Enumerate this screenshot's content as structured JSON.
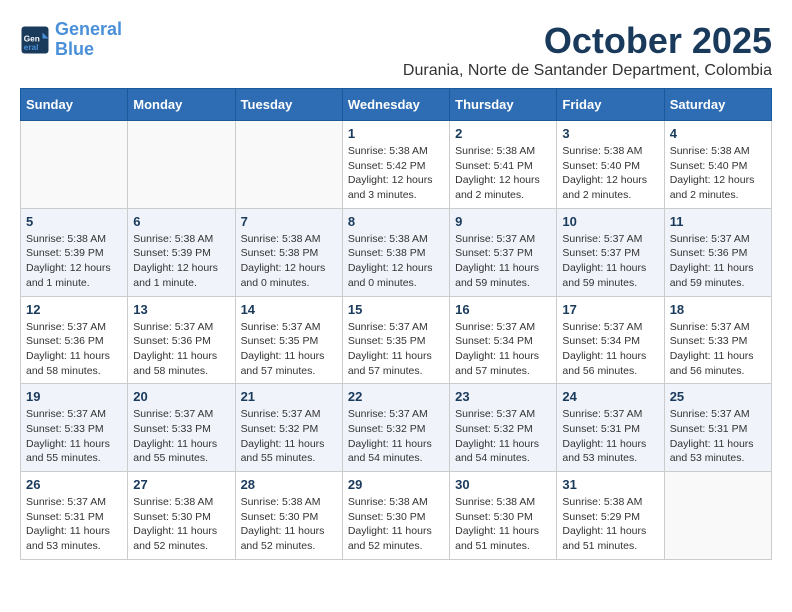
{
  "header": {
    "logo_line1": "General",
    "logo_line2": "Blue",
    "month": "October 2025",
    "location": "Durania, Norte de Santander Department, Colombia"
  },
  "weekdays": [
    "Sunday",
    "Monday",
    "Tuesday",
    "Wednesday",
    "Thursday",
    "Friday",
    "Saturday"
  ],
  "weeks": [
    [
      {
        "day": "",
        "info": ""
      },
      {
        "day": "",
        "info": ""
      },
      {
        "day": "",
        "info": ""
      },
      {
        "day": "1",
        "info": "Sunrise: 5:38 AM\nSunset: 5:42 PM\nDaylight: 12 hours and 3 minutes."
      },
      {
        "day": "2",
        "info": "Sunrise: 5:38 AM\nSunset: 5:41 PM\nDaylight: 12 hours and 2 minutes."
      },
      {
        "day": "3",
        "info": "Sunrise: 5:38 AM\nSunset: 5:40 PM\nDaylight: 12 hours and 2 minutes."
      },
      {
        "day": "4",
        "info": "Sunrise: 5:38 AM\nSunset: 5:40 PM\nDaylight: 12 hours and 2 minutes."
      }
    ],
    [
      {
        "day": "5",
        "info": "Sunrise: 5:38 AM\nSunset: 5:39 PM\nDaylight: 12 hours and 1 minute."
      },
      {
        "day": "6",
        "info": "Sunrise: 5:38 AM\nSunset: 5:39 PM\nDaylight: 12 hours and 1 minute."
      },
      {
        "day": "7",
        "info": "Sunrise: 5:38 AM\nSunset: 5:38 PM\nDaylight: 12 hours and 0 minutes."
      },
      {
        "day": "8",
        "info": "Sunrise: 5:38 AM\nSunset: 5:38 PM\nDaylight: 12 hours and 0 minutes."
      },
      {
        "day": "9",
        "info": "Sunrise: 5:37 AM\nSunset: 5:37 PM\nDaylight: 11 hours and 59 minutes."
      },
      {
        "day": "10",
        "info": "Sunrise: 5:37 AM\nSunset: 5:37 PM\nDaylight: 11 hours and 59 minutes."
      },
      {
        "day": "11",
        "info": "Sunrise: 5:37 AM\nSunset: 5:36 PM\nDaylight: 11 hours and 59 minutes."
      }
    ],
    [
      {
        "day": "12",
        "info": "Sunrise: 5:37 AM\nSunset: 5:36 PM\nDaylight: 11 hours and 58 minutes."
      },
      {
        "day": "13",
        "info": "Sunrise: 5:37 AM\nSunset: 5:36 PM\nDaylight: 11 hours and 58 minutes."
      },
      {
        "day": "14",
        "info": "Sunrise: 5:37 AM\nSunset: 5:35 PM\nDaylight: 11 hours and 57 minutes."
      },
      {
        "day": "15",
        "info": "Sunrise: 5:37 AM\nSunset: 5:35 PM\nDaylight: 11 hours and 57 minutes."
      },
      {
        "day": "16",
        "info": "Sunrise: 5:37 AM\nSunset: 5:34 PM\nDaylight: 11 hours and 57 minutes."
      },
      {
        "day": "17",
        "info": "Sunrise: 5:37 AM\nSunset: 5:34 PM\nDaylight: 11 hours and 56 minutes."
      },
      {
        "day": "18",
        "info": "Sunrise: 5:37 AM\nSunset: 5:33 PM\nDaylight: 11 hours and 56 minutes."
      }
    ],
    [
      {
        "day": "19",
        "info": "Sunrise: 5:37 AM\nSunset: 5:33 PM\nDaylight: 11 hours and 55 minutes."
      },
      {
        "day": "20",
        "info": "Sunrise: 5:37 AM\nSunset: 5:33 PM\nDaylight: 11 hours and 55 minutes."
      },
      {
        "day": "21",
        "info": "Sunrise: 5:37 AM\nSunset: 5:32 PM\nDaylight: 11 hours and 55 minutes."
      },
      {
        "day": "22",
        "info": "Sunrise: 5:37 AM\nSunset: 5:32 PM\nDaylight: 11 hours and 54 minutes."
      },
      {
        "day": "23",
        "info": "Sunrise: 5:37 AM\nSunset: 5:32 PM\nDaylight: 11 hours and 54 minutes."
      },
      {
        "day": "24",
        "info": "Sunrise: 5:37 AM\nSunset: 5:31 PM\nDaylight: 11 hours and 53 minutes."
      },
      {
        "day": "25",
        "info": "Sunrise: 5:37 AM\nSunset: 5:31 PM\nDaylight: 11 hours and 53 minutes."
      }
    ],
    [
      {
        "day": "26",
        "info": "Sunrise: 5:37 AM\nSunset: 5:31 PM\nDaylight: 11 hours and 53 minutes."
      },
      {
        "day": "27",
        "info": "Sunrise: 5:38 AM\nSunset: 5:30 PM\nDaylight: 11 hours and 52 minutes."
      },
      {
        "day": "28",
        "info": "Sunrise: 5:38 AM\nSunset: 5:30 PM\nDaylight: 11 hours and 52 minutes."
      },
      {
        "day": "29",
        "info": "Sunrise: 5:38 AM\nSunset: 5:30 PM\nDaylight: 11 hours and 52 minutes."
      },
      {
        "day": "30",
        "info": "Sunrise: 5:38 AM\nSunset: 5:30 PM\nDaylight: 11 hours and 51 minutes."
      },
      {
        "day": "31",
        "info": "Sunrise: 5:38 AM\nSunset: 5:29 PM\nDaylight: 11 hours and 51 minutes."
      },
      {
        "day": "",
        "info": ""
      }
    ]
  ]
}
